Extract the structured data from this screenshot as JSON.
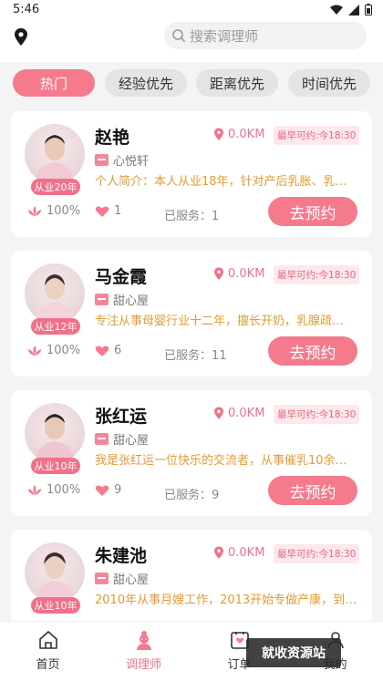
{
  "status": {
    "time": "5:46"
  },
  "search": {
    "placeholder": "搜索调理师"
  },
  "filters": [
    {
      "label": "热门",
      "active": true
    },
    {
      "label": "经验优先",
      "active": false
    },
    {
      "label": "距离优先",
      "active": false
    },
    {
      "label": "时间优先",
      "active": false
    }
  ],
  "therapists": [
    {
      "name": "赵艳",
      "experience": "从业20年",
      "distance": "0.0KM",
      "earliest": "最早可约:今18:30",
      "shop": "心悦轩",
      "intro": "个人简介：本人从业18年，针对产后乳胀、乳…",
      "rating": "100%",
      "likes": "1",
      "served": "已服务：1",
      "book": "去预约"
    },
    {
      "name": "马金霞",
      "experience": "从业12年",
      "distance": "0.0KM",
      "earliest": "最早可约:今18:30",
      "shop": "甜心屋",
      "intro": "专注从事母婴行业十二年，擅长开奶，乳腺疏…",
      "rating": "100%",
      "likes": "6",
      "served": "已服务：11",
      "book": "去预约"
    },
    {
      "name": "张红运",
      "experience": "从业10年",
      "distance": "0.0KM",
      "earliest": "最早可约:今18:30",
      "shop": "甜心屋",
      "intro": "我是张红运一位快乐的交流者，从事催乳10余…",
      "rating": "100%",
      "likes": "9",
      "served": "已服务：9",
      "book": "去预约"
    },
    {
      "name": "朱建池",
      "experience": "从业10年",
      "distance": "0.0KM",
      "earliest": "最早可约:今18:30",
      "shop": "甜心屋",
      "intro": "2010年从事月嫂工作，2013开始专做产康，到…",
      "rating": "",
      "likes": "",
      "served": "",
      "book": ""
    }
  ],
  "tabbar": [
    {
      "label": "首页",
      "icon": "home-icon",
      "active": false
    },
    {
      "label": "调理师",
      "icon": "therapist-icon",
      "active": true
    },
    {
      "label": "订单",
      "icon": "order-icon",
      "active": false
    },
    {
      "label": "我的",
      "icon": "profile-icon",
      "active": false
    }
  ],
  "watermark": "就收资源站",
  "colors": {
    "accent": "#f57a8c",
    "intro": "#e39b35"
  }
}
